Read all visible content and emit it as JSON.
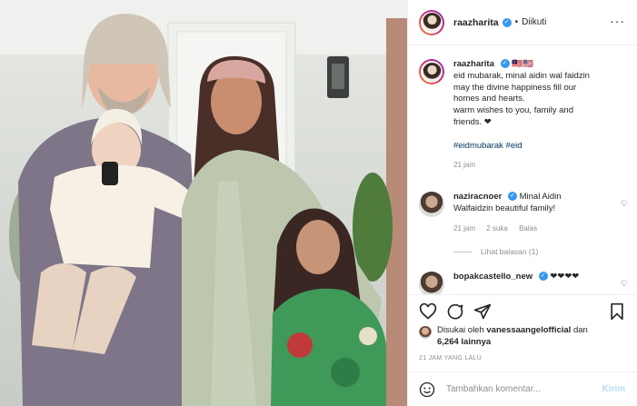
{
  "post": {
    "author": "raazharita",
    "follow_status": "Diikuti",
    "more_icon": "more-options-icon"
  },
  "caption": {
    "username": "raazharita",
    "emojis": "🇲🇾🇺🇸",
    "text_line1": "eid mubarak, minal aidin wal faidzin",
    "text_line2": "may the divine happiness fill our",
    "text_line3": "homes and hearts.",
    "text_line4": "warm wishes to you, family and",
    "text_line5": "friends. ❤",
    "hashtags": "#eidmubarak #eid",
    "time": "21 jam"
  },
  "comments": [
    {
      "username": "naziracnoer",
      "text_line1": "Minal Aidin",
      "text_line2": "Walfaidzin beautiful family!",
      "time": "21 jam",
      "likes": "2 suka",
      "reply": "Balas",
      "view_replies": "Lihat balasan (1)"
    },
    {
      "username": "bopakcastello_new",
      "text": "❤❤❤❤"
    }
  ],
  "likes": {
    "prefix": "Disukai oleh",
    "user": "vanessaangelofficial",
    "conj": "dan",
    "count": "6,264 lainnya"
  },
  "timestamp": "21 JAM YANG LALU",
  "comment_box": {
    "placeholder": "Tambahkan komentar...",
    "post_label": "Kirim"
  },
  "colors": {
    "accent_blue": "#3897f0",
    "hashtag": "#00376b",
    "muted": "#8e8e8e",
    "border": "#efefef"
  }
}
